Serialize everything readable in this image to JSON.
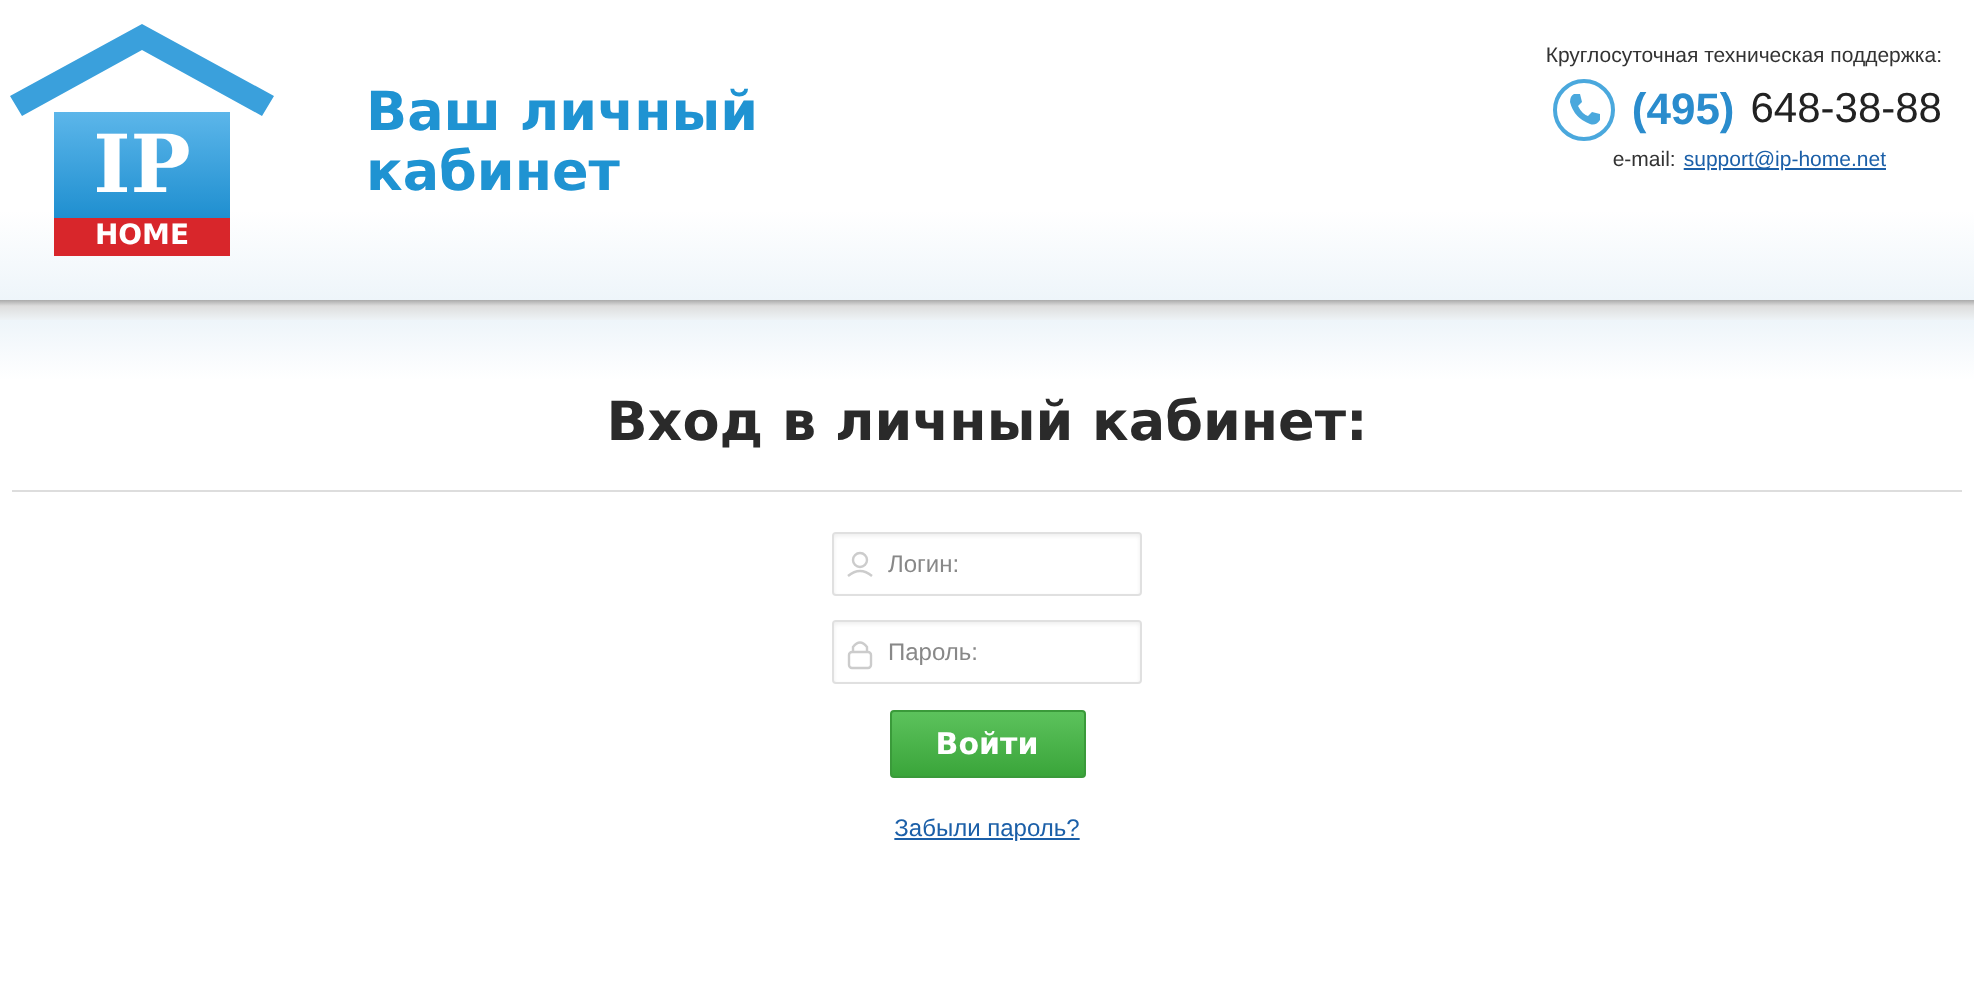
{
  "logo": {
    "mark": "IP",
    "word": "HOME"
  },
  "site_title": "Ваш личный кабинет",
  "support": {
    "caption": "Круглосуточная техническая поддержка:",
    "phone_code": "(495)",
    "phone_number": "648-38-88",
    "email_label": "e-mail:",
    "email": "support@ip-home.net"
  },
  "heading": "Вход в личный кабинет:",
  "login_field": {
    "placeholder": "Логин:"
  },
  "password_field": {
    "placeholder": "Пароль:"
  },
  "submit_button": "Войти",
  "forgot_link": "Забыли пароль?"
}
